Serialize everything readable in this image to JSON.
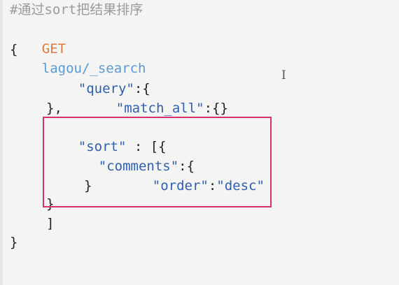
{
  "editor": {
    "comment": "#通过sort把结果排序",
    "method": "GET",
    "endpoint": "lagou/_search",
    "lines": {
      "open_brace": "{",
      "query_key": "\"query\"",
      "query_colon": ":{",
      "match_all_key": "\"match_all\"",
      "match_all_val": ":{}",
      "query_close": "},",
      "sort_key": "\"sort\"",
      "sort_rest": " : [{",
      "comments_key": "\"comments\"",
      "comments_colon": ":{",
      "order_key": "\"order\"",
      "order_colon": ":",
      "order_val": "\"desc\"",
      "inner_close": "}",
      "sort_obj_close": "}",
      "array_close": "]",
      "close_brace": "}"
    }
  },
  "cursor": {
    "glyph": "I"
  },
  "colors": {
    "method": "#e07a45",
    "endpoint": "#5a9bd6",
    "key": "#2f5fae",
    "highlight": "#d6336c"
  }
}
